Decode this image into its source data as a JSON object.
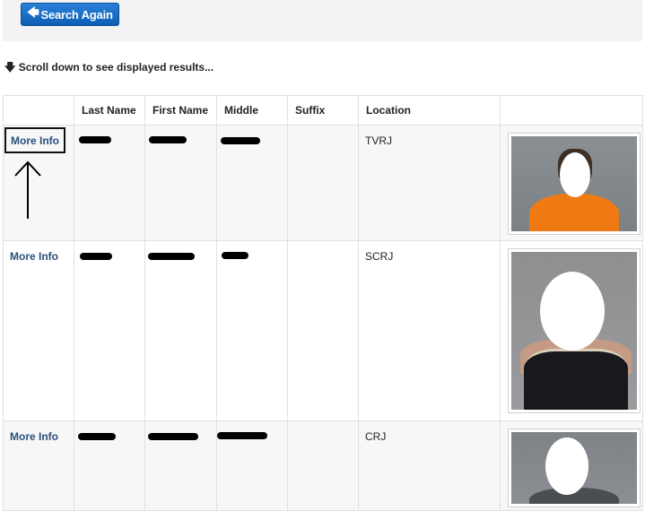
{
  "toolbar": {
    "search_again_label": "Search Again",
    "search_again_icon": "arrow-left-icon"
  },
  "hint": {
    "icon": "arrow-down-icon",
    "text": "Scroll down to see displayed results..."
  },
  "table": {
    "headers": [
      "",
      "Last Name",
      "First Name",
      "Middle",
      "Suffix",
      "Location",
      ""
    ],
    "rows": [
      {
        "link": "More Info",
        "location": "TVRJ"
      },
      {
        "link": "More Info",
        "location": "SCRJ"
      },
      {
        "link": "More Info",
        "location": "CRJ"
      }
    ]
  },
  "colors": {
    "button": "#0d5fb5",
    "link": "#2a4f7a",
    "row_alt": "#f7f7f7",
    "topbar": "#f3f3f3"
  }
}
